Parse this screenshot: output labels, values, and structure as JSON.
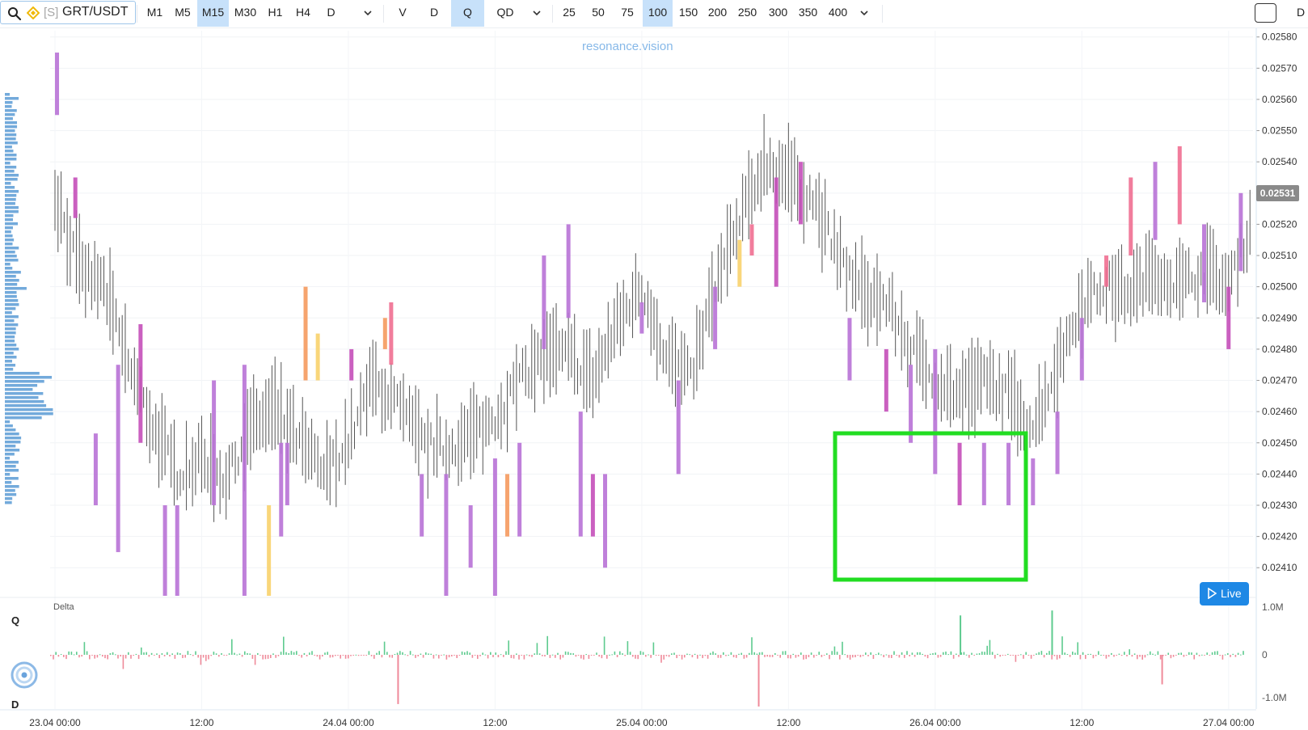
{
  "toolbar": {
    "symbol_prefix": "[S]",
    "symbol": "GRT/USDT",
    "timeframes": [
      "M1",
      "M5",
      "M15",
      "M30",
      "H1",
      "H4",
      "D"
    ],
    "active_timeframe": "M15",
    "modes": [
      "V",
      "D",
      "Q",
      "QD"
    ],
    "active_mode": "Q",
    "levels": [
      "25",
      "50",
      "75",
      "100",
      "150",
      "200",
      "250",
      "300",
      "350",
      "400"
    ],
    "active_level": "100",
    "cut_label": "D"
  },
  "watermark": "resonance.vision",
  "side_labels": {
    "top": "Q",
    "bottom": "D"
  },
  "live_button": "Live",
  "colors": {
    "accent": "#1e88e5",
    "active_bg": "#c7e1fa",
    "cluster_purple": "#b872d6",
    "cluster_magenta": "#c44fb9",
    "cluster_pink": "#ef6f91",
    "cluster_orange": "#f59a5e",
    "cluster_yellow": "#f8d16b",
    "delta_positive": "#5ecb8f",
    "delta_negative": "#ef8a9a",
    "volume_profile": "#5b9bd5",
    "highlight_box": "#22dd22"
  },
  "chart_data": [
    {
      "type": "candlestick_cluster",
      "title": "",
      "price_axis": {
        "ticks": [
          "0.02410",
          "0.02420",
          "0.02430",
          "0.02440",
          "0.02450",
          "0.02460",
          "0.02470",
          "0.02480",
          "0.02490",
          "0.02500",
          "0.02510",
          "0.02520",
          "0.02530",
          "0.02540",
          "0.02550",
          "0.02560",
          "0.02570",
          "0.02580"
        ],
        "ylim": [
          0.02401,
          0.02582
        ],
        "current_price": "0.02531"
      },
      "time_axis": {
        "ticks": [
          "23.04 00:00",
          "12:00",
          "24.04 00:00",
          "12:00",
          "25.04 00:00",
          "12:00",
          "26.04 00:00",
          "12:00",
          "27.04 00:00"
        ],
        "xlim": [
          "2024-04-23 00:00",
          "2024-04-27 02:00"
        ]
      },
      "price_path": [
        [
          "2024-04-23 00:00",
          0.0253
        ],
        [
          "2024-04-23 02:00",
          0.02505
        ],
        [
          "2024-04-23 04:00",
          0.025
        ],
        [
          "2024-04-23 06:00",
          0.02475
        ],
        [
          "2024-04-23 08:00",
          0.02455
        ],
        [
          "2024-04-23 10:00",
          0.0244
        ],
        [
          "2024-04-23 12:00",
          0.02445
        ],
        [
          "2024-04-23 14:00",
          0.02438
        ],
        [
          "2024-04-23 16:00",
          0.02455
        ],
        [
          "2024-04-23 18:00",
          0.0246
        ],
        [
          "2024-04-23 20:00",
          0.0245
        ],
        [
          "2024-04-23 22:00",
          0.0244
        ],
        [
          "2024-04-24 00:00",
          0.0245
        ],
        [
          "2024-04-24 02:00",
          0.0247
        ],
        [
          "2024-04-24 04:00",
          0.02462
        ],
        [
          "2024-04-24 06:00",
          0.0245
        ],
        [
          "2024-04-24 08:00",
          0.02448
        ],
        [
          "2024-04-24 10:00",
          0.02452
        ],
        [
          "2024-04-24 12:00",
          0.02458
        ],
        [
          "2024-04-24 14:00",
          0.0247
        ],
        [
          "2024-04-24 16:00",
          0.02478
        ],
        [
          "2024-04-24 18:00",
          0.02478
        ],
        [
          "2024-04-24 20:00",
          0.0247
        ],
        [
          "2024-04-24 22:00",
          0.02488
        ],
        [
          "2024-04-25 00:00",
          0.025
        ],
        [
          "2024-04-25 02:00",
          0.02478
        ],
        [
          "2024-04-25 04:00",
          0.0247
        ],
        [
          "2024-04-25 06:00",
          0.025
        ],
        [
          "2024-04-25 08:00",
          0.0252
        ],
        [
          "2024-04-25 10:00",
          0.0254
        ],
        [
          "2024-04-25 12:00",
          0.02535
        ],
        [
          "2024-04-25 14:00",
          0.02528
        ],
        [
          "2024-04-25 16:00",
          0.0251
        ],
        [
          "2024-04-25 18:00",
          0.02498
        ],
        [
          "2024-04-25 20:00",
          0.02495
        ],
        [
          "2024-04-25 22:00",
          0.0248
        ],
        [
          "2024-04-26 00:00",
          0.0247
        ],
        [
          "2024-04-26 02:00",
          0.02465
        ],
        [
          "2024-04-26 04:00",
          0.0247
        ],
        [
          "2024-04-26 06:00",
          0.02465
        ],
        [
          "2024-04-26 08:00",
          0.02455
        ],
        [
          "2024-04-26 10:00",
          0.02475
        ],
        [
          "2024-04-26 12:00",
          0.02495
        ],
        [
          "2024-04-26 14:00",
          0.025
        ],
        [
          "2024-04-26 16:00",
          0.02498
        ],
        [
          "2024-04-26 18:00",
          0.02505
        ],
        [
          "2024-04-26 20:00",
          0.025
        ],
        [
          "2024-04-26 22:00",
          0.02505
        ],
        [
          "2024-04-27 00:00",
          0.025
        ],
        [
          "2024-04-27 02:00",
          0.02522
        ]
      ],
      "cluster_bars": [
        [
          "2024-04-23 00:10",
          0.02555,
          0.02575,
          "purple"
        ],
        [
          "2024-04-23 01:40",
          0.02522,
          0.02535,
          "magenta"
        ],
        [
          "2024-04-23 03:20",
          0.02453,
          0.0243,
          "purple"
        ],
        [
          "2024-04-23 05:10",
          0.02475,
          0.02415,
          "purple"
        ],
        [
          "2024-04-23 07:00",
          0.02488,
          0.0245,
          "magenta"
        ],
        [
          "2024-04-23 09:00",
          0.0243,
          0.02401,
          "purple"
        ],
        [
          "2024-04-23 10:00",
          0.0243,
          0.02401,
          "purple"
        ],
        [
          "2024-04-23 13:00",
          0.0247,
          0.0243,
          "purple"
        ],
        [
          "2024-04-23 15:30",
          0.02475,
          0.02401,
          "purple"
        ],
        [
          "2024-04-23 17:30",
          0.0243,
          0.02401,
          "yellow"
        ],
        [
          "2024-04-23 18:30",
          0.0245,
          0.0242,
          "purple"
        ],
        [
          "2024-04-23 19:00",
          0.0245,
          0.0243,
          "purple"
        ],
        [
          "2024-04-23 20:30",
          0.025,
          0.0247,
          "orange"
        ],
        [
          "2024-04-23 21:30",
          0.02485,
          0.0247,
          "yellow"
        ],
        [
          "2024-04-24 00:15",
          0.0248,
          0.0247,
          "magenta"
        ],
        [
          "2024-04-24 03:00",
          0.0249,
          0.0248,
          "orange"
        ],
        [
          "2024-04-24 03:30",
          0.02495,
          0.02475,
          "pink"
        ],
        [
          "2024-04-24 06:00",
          0.0244,
          0.0242,
          "purple"
        ],
        [
          "2024-04-24 08:00",
          0.0244,
          0.02401,
          "purple"
        ],
        [
          "2024-04-24 10:00",
          0.0243,
          0.0241,
          "purple"
        ],
        [
          "2024-04-24 12:00",
          0.02445,
          0.02401,
          "purple"
        ],
        [
          "2024-04-24 13:00",
          0.0244,
          0.0242,
          "orange"
        ],
        [
          "2024-04-24 14:00",
          0.0245,
          0.0242,
          "purple"
        ],
        [
          "2024-04-24 16:00",
          0.0251,
          0.0248,
          "purple"
        ],
        [
          "2024-04-24 18:00",
          0.0252,
          0.0249,
          "purple"
        ],
        [
          "2024-04-24 19:00",
          0.0246,
          0.0242,
          "purple"
        ],
        [
          "2024-04-24 20:00",
          0.0244,
          0.0242,
          "magenta"
        ],
        [
          "2024-04-24 21:00",
          0.0244,
          0.0241,
          "purple"
        ],
        [
          "2024-04-25 00:00",
          0.02495,
          0.02485,
          "purple"
        ],
        [
          "2024-04-25 03:00",
          0.0247,
          0.0244,
          "purple"
        ],
        [
          "2024-04-25 06:00",
          0.025,
          0.0248,
          "purple"
        ],
        [
          "2024-04-25 08:00",
          0.02515,
          0.025,
          "yellow"
        ],
        [
          "2024-04-25 09:00",
          0.0252,
          0.0251,
          "pink"
        ],
        [
          "2024-04-25 11:00",
          0.02535,
          0.025,
          "magenta"
        ],
        [
          "2024-04-25 13:00",
          0.0254,
          0.0252,
          "magenta"
        ],
        [
          "2024-04-25 17:00",
          0.0249,
          0.0247,
          "purple"
        ],
        [
          "2024-04-25 20:00",
          0.0248,
          0.0246,
          "magenta"
        ],
        [
          "2024-04-25 22:00",
          0.02475,
          0.0245,
          "purple"
        ],
        [
          "2024-04-26 00:00",
          0.0248,
          0.0244,
          "purple"
        ],
        [
          "2024-04-26 02:00",
          0.0245,
          0.0243,
          "magenta"
        ],
        [
          "2024-04-26 04:00",
          0.0245,
          0.0243,
          "purple"
        ],
        [
          "2024-04-26 06:00",
          0.0245,
          0.0243,
          "purple"
        ],
        [
          "2024-04-26 08:00",
          0.02445,
          0.0243,
          "purple"
        ],
        [
          "2024-04-26 10:00",
          0.0246,
          0.0244,
          "purple"
        ],
        [
          "2024-04-26 12:00",
          0.0249,
          0.0247,
          "purple"
        ],
        [
          "2024-04-26 14:00",
          0.0251,
          0.025,
          "pink"
        ],
        [
          "2024-04-26 16:00",
          0.02535,
          0.0251,
          "pink"
        ],
        [
          "2024-04-26 18:00",
          0.0254,
          0.02515,
          "purple"
        ],
        [
          "2024-04-26 20:00",
          0.02545,
          0.0252,
          "pink"
        ],
        [
          "2024-04-26 22:00",
          0.0252,
          0.02495,
          "purple"
        ],
        [
          "2024-04-27 00:00",
          0.025,
          0.0248,
          "magenta"
        ],
        [
          "2024-04-27 01:00",
          0.0253,
          0.02505,
          "purple"
        ]
      ]
    },
    {
      "type": "bar",
      "title": "Delta",
      "y_ticks": [
        "1.0M",
        "0",
        "-1.0M"
      ],
      "ylim": [
        -1100000,
        1100000
      ],
      "notable_spikes": [
        [
          "2024-04-24 04:00",
          -1000000
        ],
        [
          "2024-04-25 09:30",
          -1050000
        ],
        [
          "2024-04-26 02:00",
          800000
        ],
        [
          "2024-04-26 09:30",
          900000
        ],
        [
          "2024-04-26 18:30",
          -600000
        ]
      ]
    }
  ]
}
